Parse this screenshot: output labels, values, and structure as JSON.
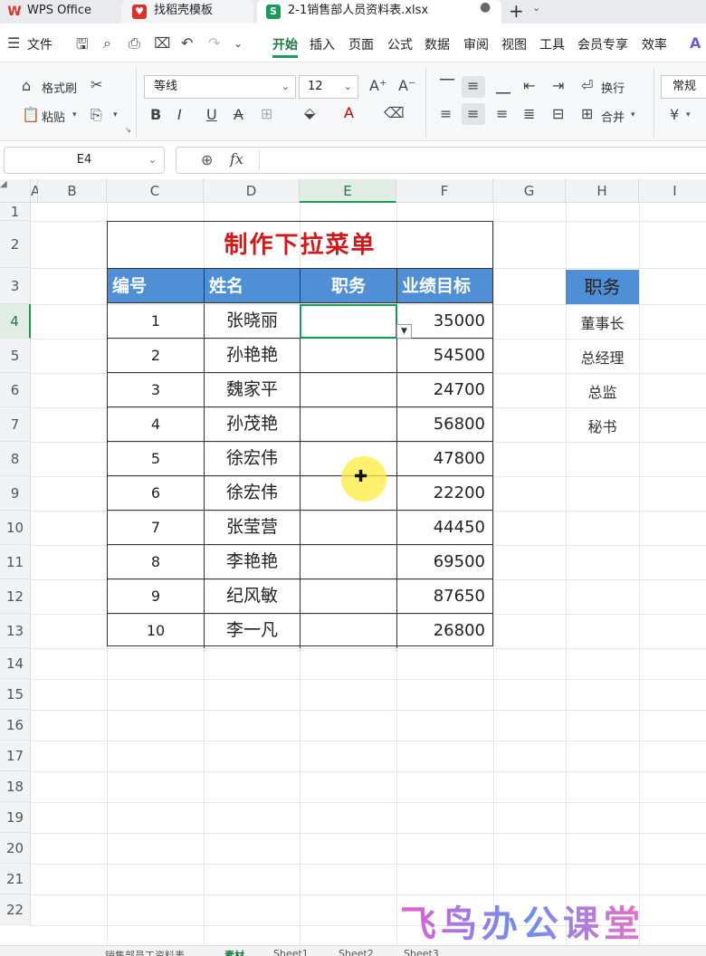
{
  "tabbar": {
    "app": "WPS Office",
    "template_tab": "找稻壳模板",
    "file_tab": "2-1销售部人员资料表.xlsx"
  },
  "menu": {
    "items": [
      "文件",
      "开始",
      "插入",
      "页面",
      "公式",
      "数据",
      "审阅",
      "视图",
      "工具",
      "会员专享",
      "效率"
    ],
    "active": "开始"
  },
  "ribbon": {
    "format_painter": "格式刷",
    "paste": "粘贴",
    "font": "等线",
    "font_size": "12",
    "wrap": "换行",
    "merge": "合并",
    "number_format": "常规",
    "currency": "¥"
  },
  "formula_bar": {
    "name_box": "E4",
    "formula": ""
  },
  "sheet": {
    "columns": [
      "A",
      "B",
      "C",
      "D",
      "E",
      "F",
      "G",
      "H",
      "I"
    ],
    "selected_column": "E",
    "rows": [
      "1",
      "2",
      "3",
      "4",
      "5",
      "6",
      "7",
      "8",
      "9",
      "10",
      "11",
      "12",
      "13",
      "14",
      "15",
      "16",
      "17",
      "18",
      "19",
      "20",
      "21",
      "22"
    ],
    "selected_row": "4"
  },
  "table": {
    "title": "制作下拉菜单",
    "headers": [
      "编号",
      "姓名",
      "职务",
      "业绩目标"
    ],
    "rows": [
      {
        "id": "1",
        "name": "张晓丽",
        "role": "",
        "target": "35000"
      },
      {
        "id": "2",
        "name": "孙艳艳",
        "role": "",
        "target": "54500"
      },
      {
        "id": "3",
        "name": "魏家平",
        "role": "",
        "target": "24700"
      },
      {
        "id": "4",
        "name": "孙茂艳",
        "role": "",
        "target": "56800"
      },
      {
        "id": "5",
        "name": "徐宏伟",
        "role": "",
        "target": "47800"
      },
      {
        "id": "6",
        "name": "徐宏伟",
        "role": "",
        "target": "22200"
      },
      {
        "id": "7",
        "name": "张莹营",
        "role": "",
        "target": "44450"
      },
      {
        "id": "8",
        "name": "李艳艳",
        "role": "",
        "target": "69500"
      },
      {
        "id": "9",
        "name": "纪风敏",
        "role": "",
        "target": "87650"
      },
      {
        "id": "10",
        "name": "李一凡",
        "role": "",
        "target": "26800"
      }
    ]
  },
  "side_list": {
    "header": "职务",
    "items": [
      "董事长",
      "总经理",
      "总监",
      "秘书"
    ]
  },
  "watermark": "飞鸟办公课堂",
  "sheet_tabs": [
    "销售部员工资料表",
    "素材",
    "Sheet1",
    "Sheet2",
    "Sheet3"
  ],
  "active_sheet_tab": "素材",
  "colors": {
    "header_blue": "#4f8fd6",
    "title_red": "#d0191b",
    "accent_green": "#1b9a5a"
  }
}
